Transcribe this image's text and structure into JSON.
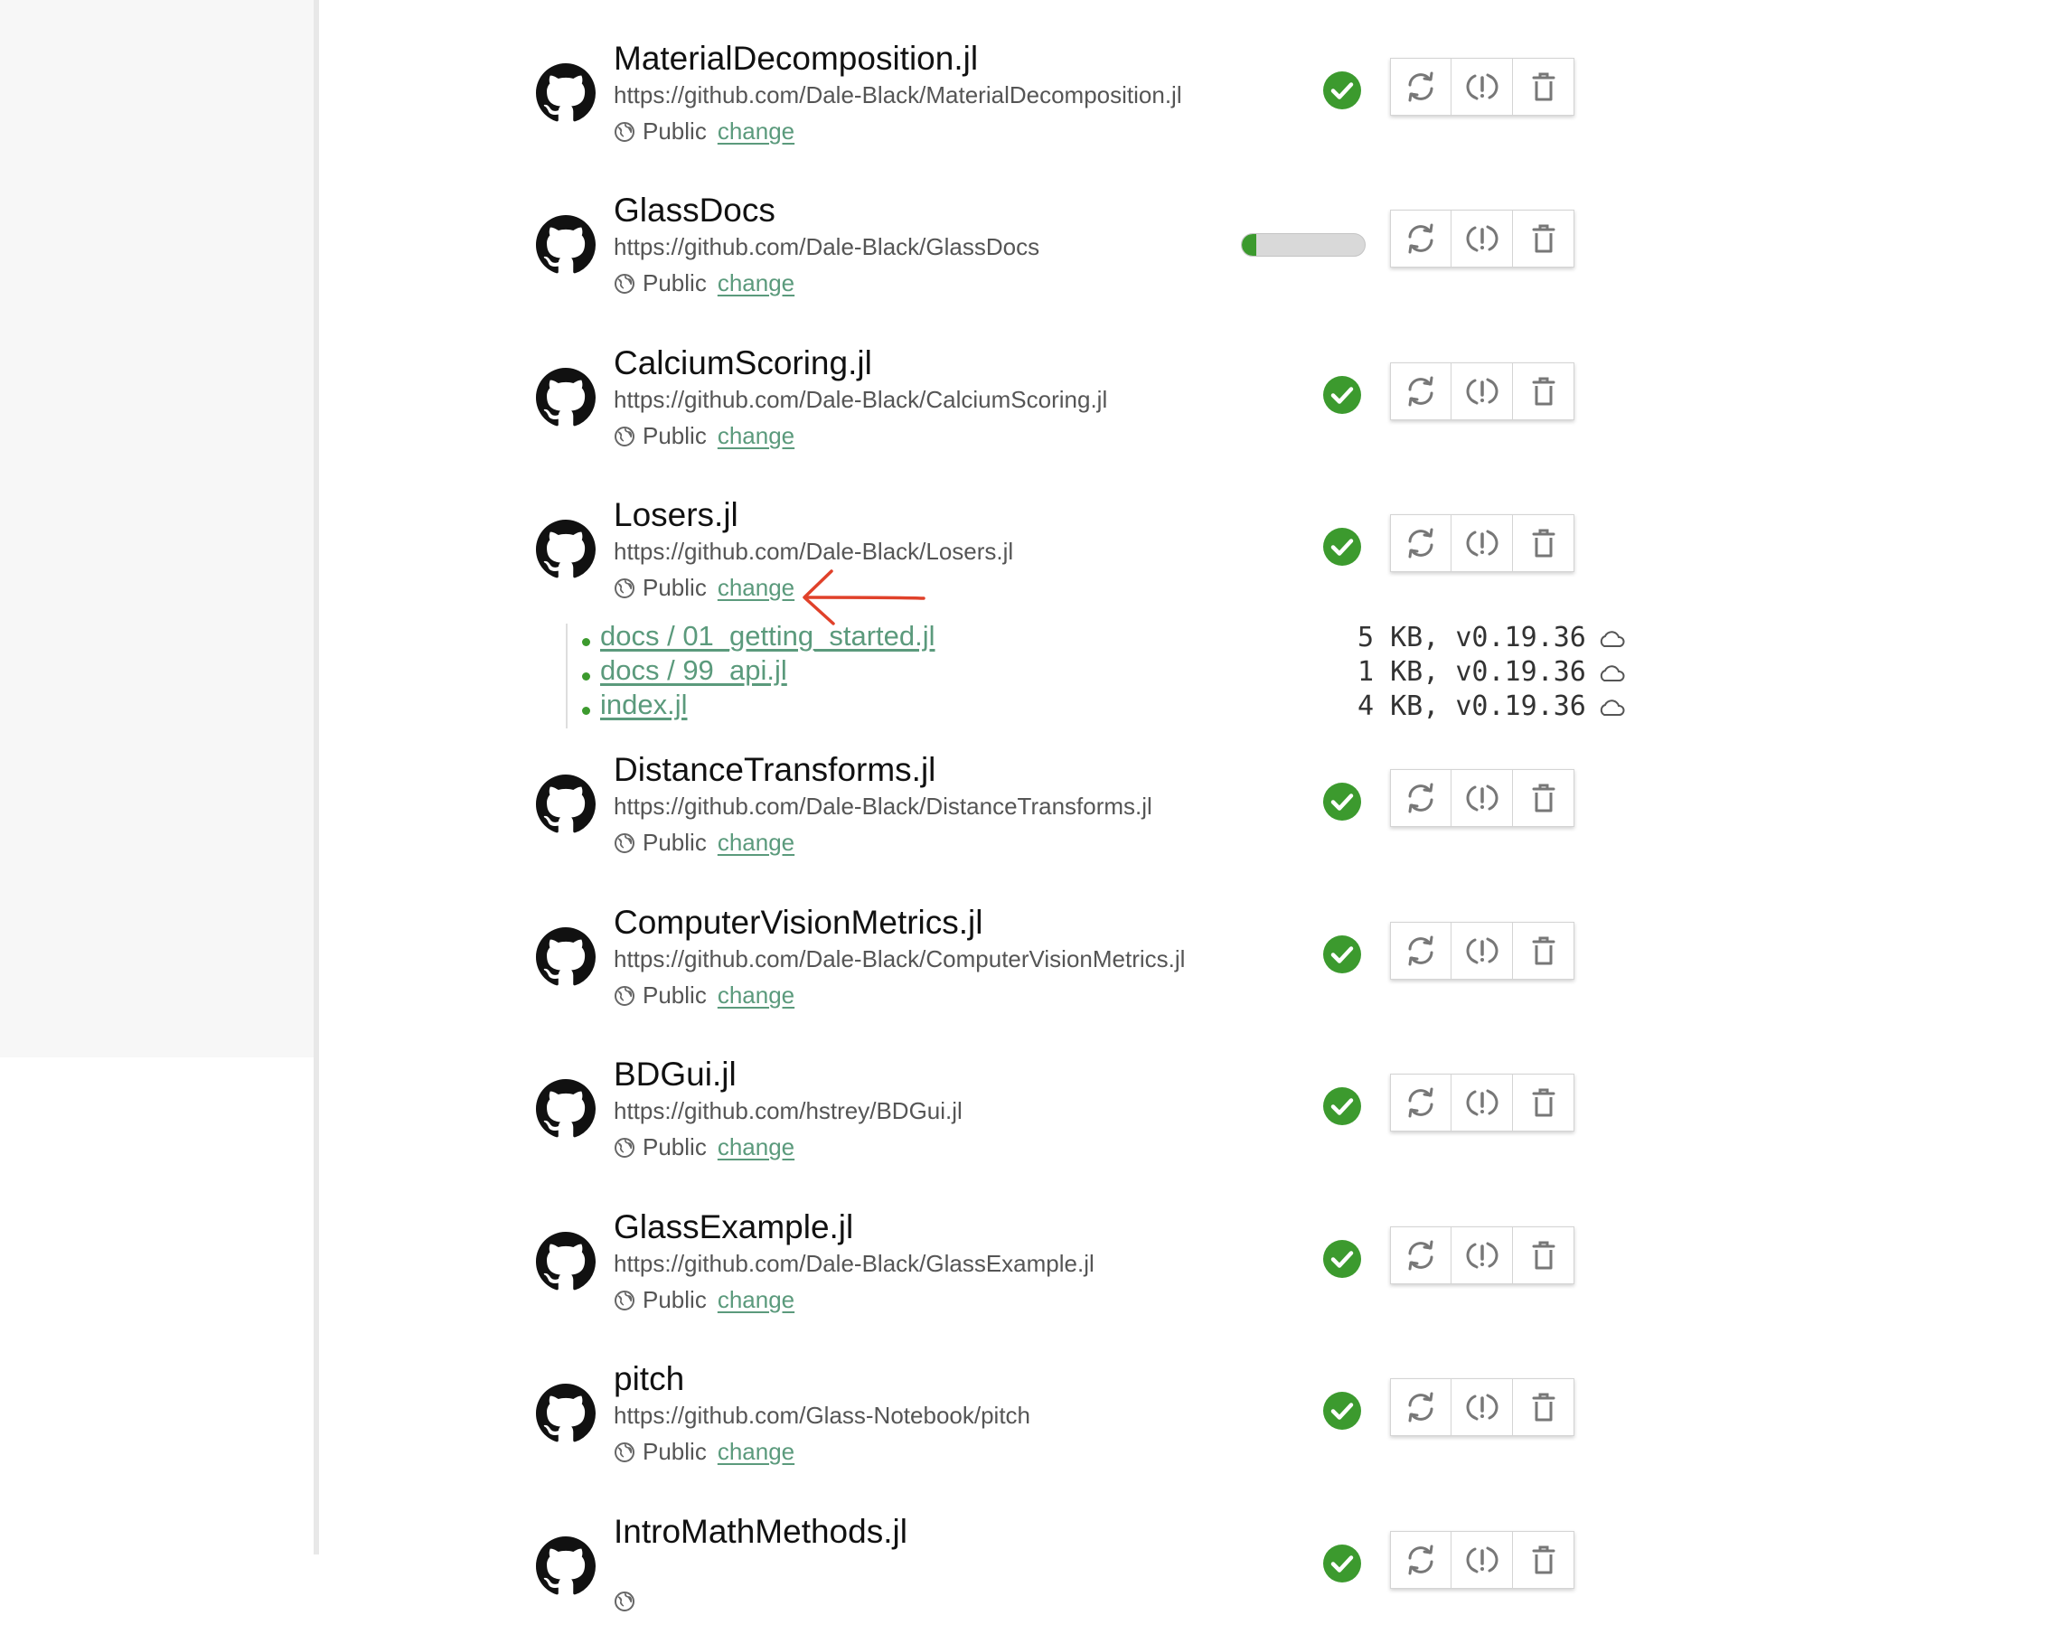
{
  "repos": [
    {
      "name": "MaterialDecomposition.jl",
      "url": "https://github.com/Dale-Black/MaterialDecomposition.jl",
      "visibility": "Public",
      "change_label": "change",
      "status": "synced"
    },
    {
      "name": "GlassDocs",
      "url": "https://github.com/Dale-Black/GlassDocs",
      "visibility": "Public",
      "change_label": "change",
      "status": "syncing",
      "progress": 0.12
    },
    {
      "name": "CalciumScoring.jl",
      "url": "https://github.com/Dale-Black/CalciumScoring.jl",
      "visibility": "Public",
      "change_label": "change",
      "status": "synced"
    },
    {
      "name": "Losers.jl",
      "url": "https://github.com/Dale-Black/Losers.jl",
      "visibility": "Public",
      "change_label": "change",
      "status": "synced"
    },
    {
      "name": "DistanceTransforms.jl",
      "url": "https://github.com/Dale-Black/DistanceTransforms.jl",
      "visibility": "Public",
      "change_label": "change",
      "status": "synced"
    },
    {
      "name": "ComputerVisionMetrics.jl",
      "url": "https://github.com/Dale-Black/ComputerVisionMetrics.jl",
      "visibility": "Public",
      "change_label": "change",
      "status": "synced"
    },
    {
      "name": "BDGui.jl",
      "url": "https://github.com/hstrey/BDGui.jl",
      "visibility": "Public",
      "change_label": "change",
      "status": "synced"
    },
    {
      "name": "GlassExample.jl",
      "url": "https://github.com/Dale-Black/GlassExample.jl",
      "visibility": "Public",
      "change_label": "change",
      "status": "synced"
    },
    {
      "name": "pitch",
      "url": "https://github.com/Glass-Notebook/pitch",
      "visibility": "Public",
      "change_label": "change",
      "status": "synced"
    },
    {
      "name": "IntroMathMethods.jl",
      "url": "",
      "visibility": "",
      "change_label": "",
      "status": "synced"
    }
  ],
  "files": [
    {
      "path": "docs / 01_getting_started.jl",
      "meta": "5 KB, v0.19.36"
    },
    {
      "path": "docs / 99_api.jl",
      "meta": "1 KB, v0.19.36"
    },
    {
      "path": "index.jl",
      "meta": "4 KB, v0.19.36"
    }
  ],
  "icons": {
    "repo_logo": "github-icon",
    "visibility": "globe-icon",
    "status": "check-circle-icon",
    "actions": [
      "refresh-icon",
      "force-sync-icon",
      "trash-icon"
    ],
    "file_status": "cloud-icon",
    "annotation": "red-arrow-icon"
  },
  "colors": {
    "accent_green": "#3c9a2e",
    "link_green": "#5b9a7c",
    "annotation_red": "#e0412a"
  }
}
